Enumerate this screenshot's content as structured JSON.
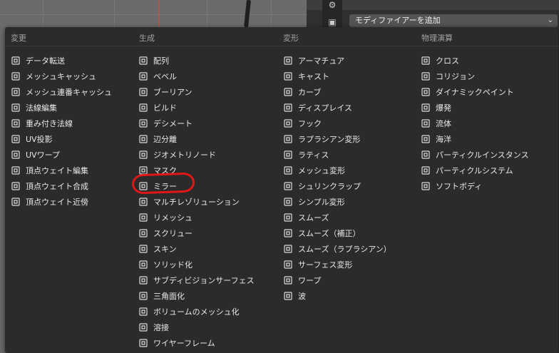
{
  "header": {
    "add_modifier_label": "モディファイアーを追加"
  },
  "menu": {
    "columns": [
      {
        "title": "変更",
        "items": [
          {
            "label": "データ転送",
            "icon": "data-transfer-icon"
          },
          {
            "label": "メッシュキャッシュ",
            "icon": "mesh-cache-icon"
          },
          {
            "label": "メッシュ連番キャッシュ",
            "icon": "mesh-sequence-cache-icon"
          },
          {
            "label": "法線編集",
            "icon": "normal-edit-icon"
          },
          {
            "label": "重み付き法線",
            "icon": "weighted-normal-icon"
          },
          {
            "label": "UV投影",
            "icon": "uv-project-icon"
          },
          {
            "label": "UVワープ",
            "icon": "uv-warp-icon"
          },
          {
            "label": "頂点ウェイト編集",
            "icon": "vertex-weight-edit-icon"
          },
          {
            "label": "頂点ウェイト合成",
            "icon": "vertex-weight-mix-icon"
          },
          {
            "label": "頂点ウェイト近傍",
            "icon": "vertex-weight-proximity-icon"
          }
        ]
      },
      {
        "title": "生成",
        "items": [
          {
            "label": "配列",
            "icon": "array-icon"
          },
          {
            "label": "ベベル",
            "icon": "bevel-icon"
          },
          {
            "label": "ブーリアン",
            "icon": "boolean-icon"
          },
          {
            "label": "ビルド",
            "icon": "build-icon"
          },
          {
            "label": "デシメート",
            "icon": "decimate-icon"
          },
          {
            "label": "辺分離",
            "icon": "edge-split-icon"
          },
          {
            "label": "ジオメトリノード",
            "icon": "geometry-nodes-icon"
          },
          {
            "label": "マスク",
            "icon": "mask-icon"
          },
          {
            "label": "ミラー",
            "icon": "mirror-icon"
          },
          {
            "label": "マルチレゾリューション",
            "icon": "multiresolution-icon"
          },
          {
            "label": "リメッシュ",
            "icon": "remesh-icon"
          },
          {
            "label": "スクリュー",
            "icon": "screw-icon"
          },
          {
            "label": "スキン",
            "icon": "skin-icon"
          },
          {
            "label": "ソリッド化",
            "icon": "solidify-icon"
          },
          {
            "label": "サブディビジョンサーフェス",
            "icon": "subdivision-surface-icon"
          },
          {
            "label": "三角面化",
            "icon": "triangulate-icon"
          },
          {
            "label": "ボリュームのメッシュ化",
            "icon": "volume-to-mesh-icon"
          },
          {
            "label": "溶接",
            "icon": "weld-icon"
          },
          {
            "label": "ワイヤーフレーム",
            "icon": "wireframe-icon"
          }
        ]
      },
      {
        "title": "変形",
        "items": [
          {
            "label": "アーマチュア",
            "icon": "armature-icon"
          },
          {
            "label": "キャスト",
            "icon": "cast-icon"
          },
          {
            "label": "カーブ",
            "icon": "curve-icon"
          },
          {
            "label": "ディスプレイス",
            "icon": "displace-icon"
          },
          {
            "label": "フック",
            "icon": "hook-icon"
          },
          {
            "label": "ラプラシアン変形",
            "icon": "laplacian-deform-icon"
          },
          {
            "label": "ラティス",
            "icon": "lattice-icon"
          },
          {
            "label": "メッシュ変形",
            "icon": "mesh-deform-icon"
          },
          {
            "label": "シュリンクラップ",
            "icon": "shrinkwrap-icon"
          },
          {
            "label": "シンプル変形",
            "icon": "simple-deform-icon"
          },
          {
            "label": "スムーズ",
            "icon": "smooth-icon"
          },
          {
            "label": "スムーズ（補正）",
            "icon": "smooth-corrective-icon"
          },
          {
            "label": "スムーズ（ラプラシアン）",
            "icon": "smooth-laplacian-icon"
          },
          {
            "label": "サーフェス変形",
            "icon": "surface-deform-icon"
          },
          {
            "label": "ワープ",
            "icon": "warp-icon"
          },
          {
            "label": "波",
            "icon": "wave-icon"
          }
        ]
      },
      {
        "title": "物理演算",
        "items": [
          {
            "label": "クロス",
            "icon": "cloth-icon"
          },
          {
            "label": "コリジョン",
            "icon": "collision-icon"
          },
          {
            "label": "ダイナミックペイント",
            "icon": "dynamic-paint-icon"
          },
          {
            "label": "爆発",
            "icon": "explode-icon"
          },
          {
            "label": "流体",
            "icon": "fluid-icon"
          },
          {
            "label": "海洋",
            "icon": "ocean-icon"
          },
          {
            "label": "パーティクルインスタンス",
            "icon": "particle-instance-icon"
          },
          {
            "label": "パーティクルシステム",
            "icon": "particle-system-icon"
          },
          {
            "label": "ソフトボディ",
            "icon": "soft-body-icon"
          }
        ]
      }
    ]
  },
  "colors": {
    "menu_bg": "#2b2b2b",
    "highlight_circle": "#e01717",
    "axis_red": "#b4534f"
  }
}
